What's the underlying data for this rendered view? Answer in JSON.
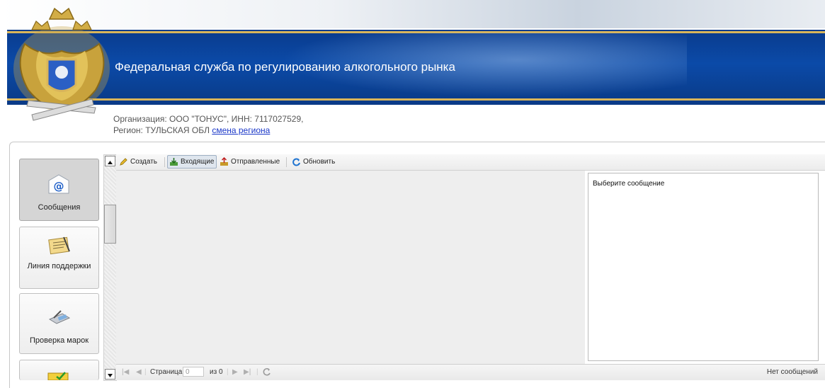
{
  "header": {
    "title": "Федеральная служба по регулированию алкогольного рынка",
    "org_line": "Организация: ООО \"ТОНУС\", ИНН: 7117027529,",
    "region_prefix": "Регион: ТУЛЬСКАЯ ОБЛ",
    "region_link": "смена региона"
  },
  "sidebar": {
    "items": [
      {
        "label": "Сообщения",
        "icon": "envelope-icon",
        "active": true
      },
      {
        "label": "Линия поддержки",
        "icon": "notepad-icon",
        "active": false
      },
      {
        "label": "Проверка марок",
        "icon": "scanner-icon",
        "active": false
      },
      {
        "label": "",
        "icon": "folder-check-icon",
        "active": false
      }
    ]
  },
  "toolbar": {
    "create": "Создать",
    "inbox": "Входящие",
    "sent": "Отправленные",
    "refresh": "Обновить"
  },
  "preview": {
    "placeholder": "Выберите сообщение"
  },
  "pager": {
    "page_label": "Страница",
    "page_value": "0",
    "of_label": "из 0",
    "status": "Нет сообщений"
  },
  "colors": {
    "banner_blue": "#0b4aa8",
    "gold_line": "#d9b55a",
    "link": "#1a37c8"
  }
}
